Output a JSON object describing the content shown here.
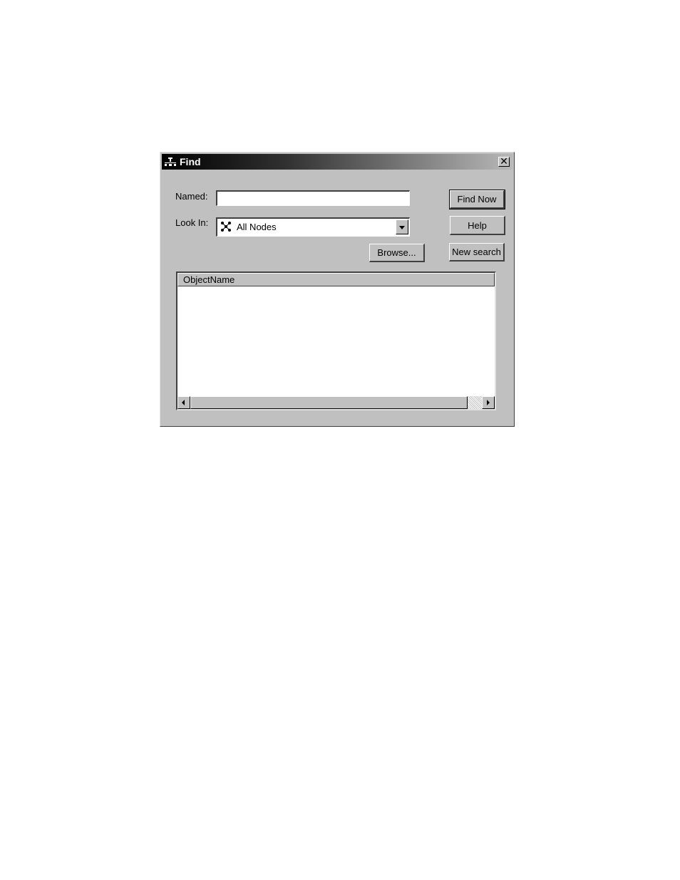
{
  "window": {
    "title": "Find",
    "close_label": "✕"
  },
  "form": {
    "named_label": "Named:",
    "named_value": "",
    "lookin_label": "Look In:",
    "lookin_value": "All Nodes"
  },
  "buttons": {
    "find_now": "Find Now",
    "help": "Help",
    "new_search": "New search",
    "browse": "Browse..."
  },
  "results": {
    "columns": [
      "ObjectName"
    ],
    "rows": []
  },
  "icons": {
    "app": "network-app-icon",
    "lookin": "network-nodes-icon"
  }
}
